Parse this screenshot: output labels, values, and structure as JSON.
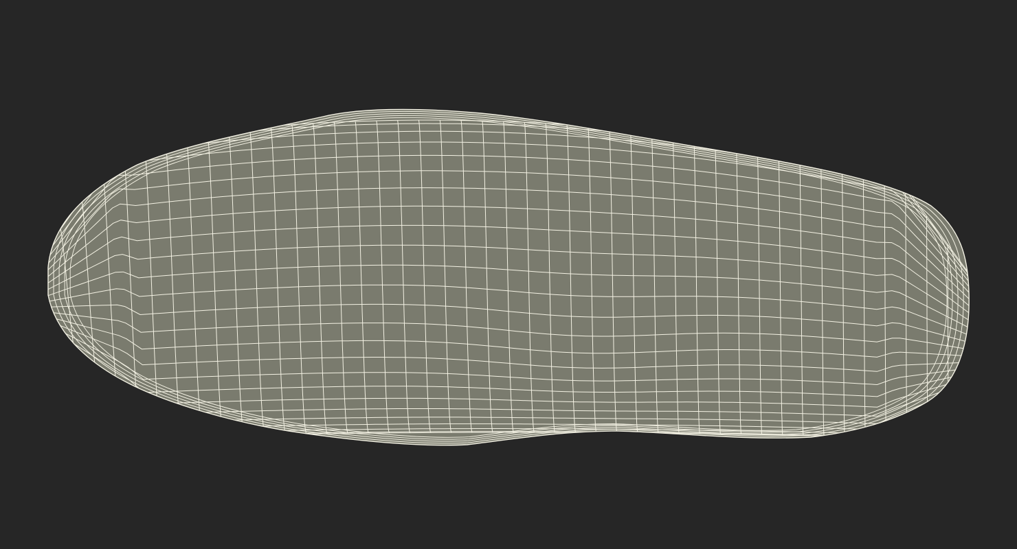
{
  "viewport": {
    "background_color": "#262626"
  },
  "mesh": {
    "icon": "wireframe-mesh-icon",
    "fill_color": "#7a7b6e",
    "edge_color": "#f4f2e4"
  }
}
